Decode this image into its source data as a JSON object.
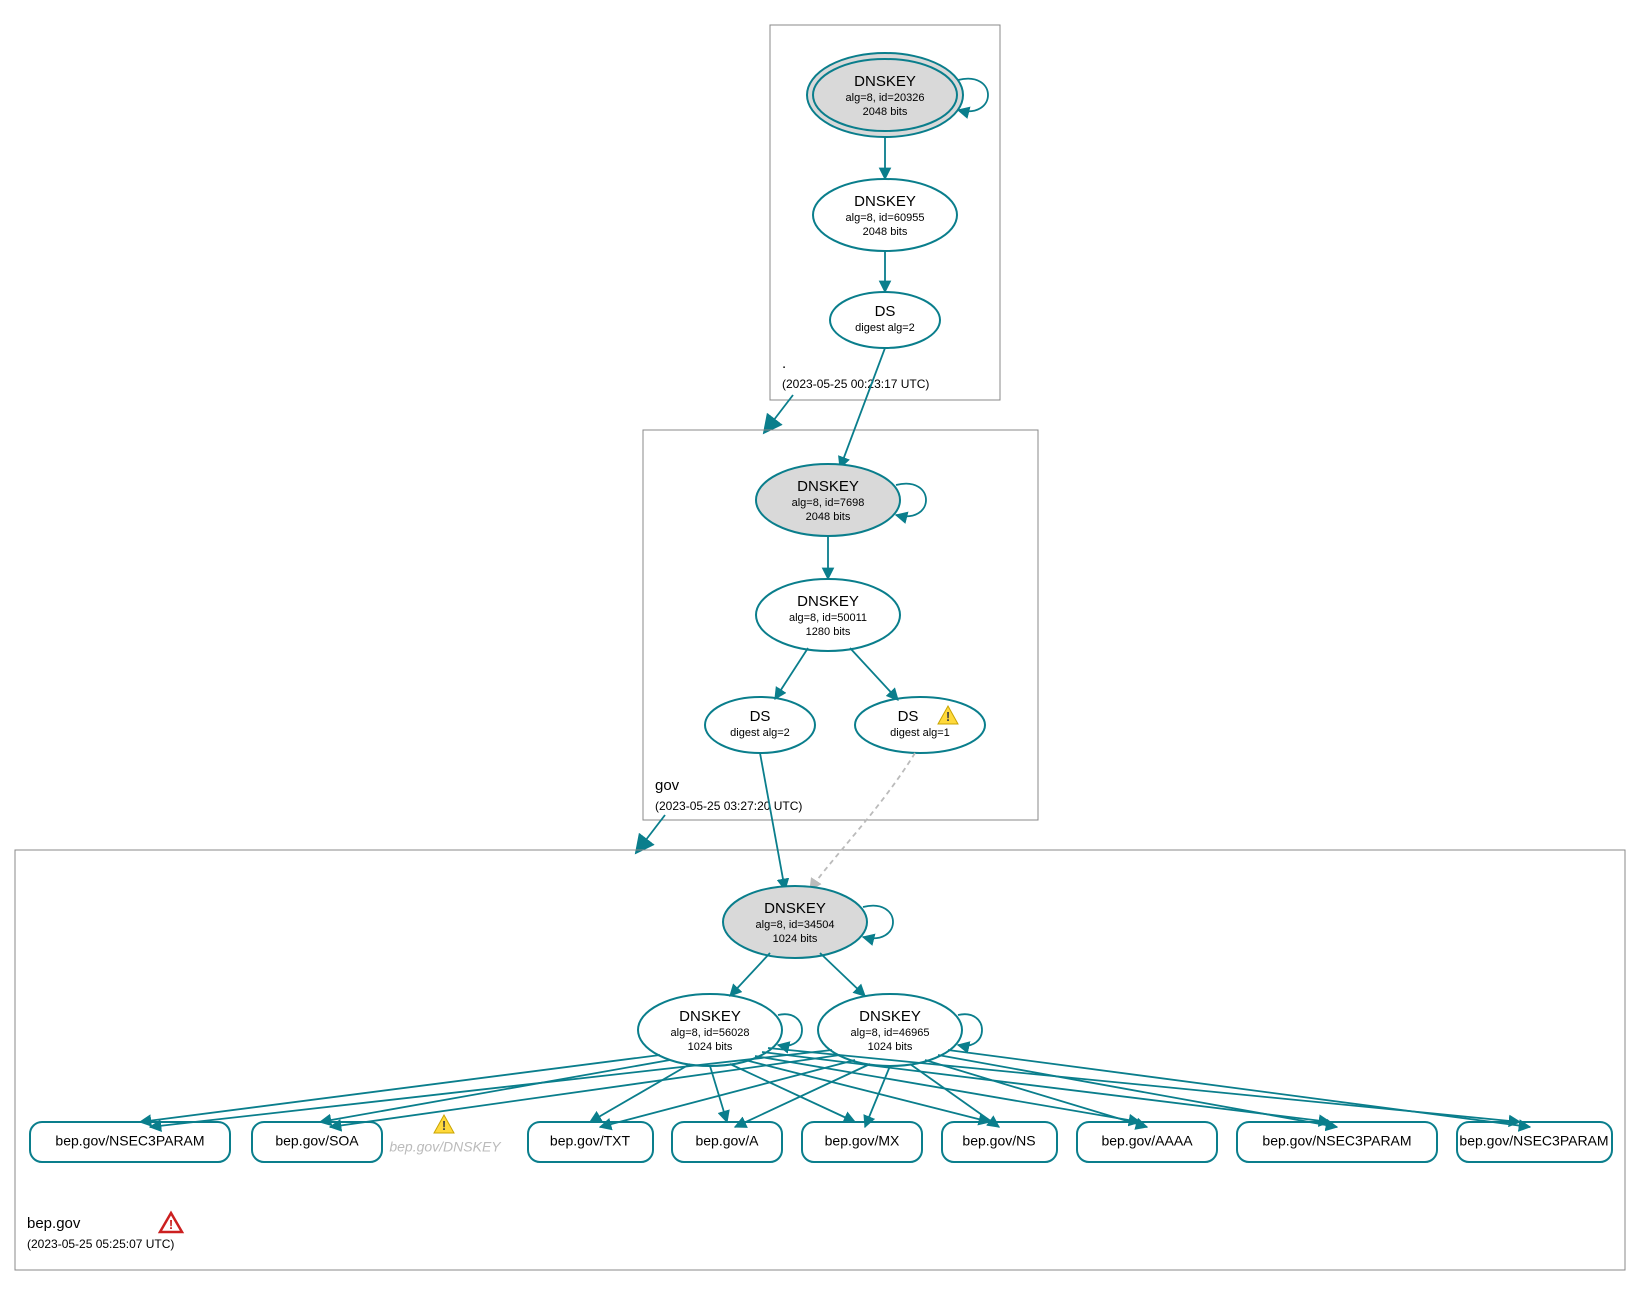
{
  "zones": {
    "root": {
      "name": ".",
      "timestamp": "(2023-05-25 00:23:17 UTC)"
    },
    "gov": {
      "name": "gov",
      "timestamp": "(2023-05-25 03:27:20 UTC)"
    },
    "bep": {
      "name": "bep.gov",
      "timestamp": "(2023-05-25 05:25:07 UTC)"
    }
  },
  "nodes": {
    "root_ksk": {
      "title": "DNSKEY",
      "sub1": "alg=8, id=20326",
      "sub2": "2048 bits"
    },
    "root_zsk": {
      "title": "DNSKEY",
      "sub1": "alg=8, id=60955",
      "sub2": "2048 bits"
    },
    "root_ds": {
      "title": "DS",
      "sub1": "digest alg=2"
    },
    "gov_ksk": {
      "title": "DNSKEY",
      "sub1": "alg=8, id=7698",
      "sub2": "2048 bits"
    },
    "gov_zsk": {
      "title": "DNSKEY",
      "sub1": "alg=8, id=50011",
      "sub2": "1280 bits"
    },
    "gov_ds1": {
      "title": "DS",
      "sub1": "digest alg=2"
    },
    "gov_ds2": {
      "title": "DS",
      "sub1": "digest alg=1"
    },
    "bep_ksk": {
      "title": "DNSKEY",
      "sub1": "alg=8, id=34504",
      "sub2": "1024 bits"
    },
    "bep_zsk1": {
      "title": "DNSKEY",
      "sub1": "alg=8, id=56028",
      "sub2": "1024 bits"
    },
    "bep_zsk2": {
      "title": "DNSKEY",
      "sub1": "alg=8, id=46965",
      "sub2": "1024 bits"
    },
    "bep_dnskey_faded": {
      "label": "bep.gov/DNSKEY"
    }
  },
  "rrsets": {
    "r0": "bep.gov/NSEC3PARAM",
    "r1": "bep.gov/SOA",
    "r2": "bep.gov/TXT",
    "r3": "bep.gov/A",
    "r4": "bep.gov/MX",
    "r5": "bep.gov/NS",
    "r6": "bep.gov/AAAA",
    "r7": "bep.gov/NSEC3PARAM",
    "r8": "bep.gov/NSEC3PARAM"
  }
}
